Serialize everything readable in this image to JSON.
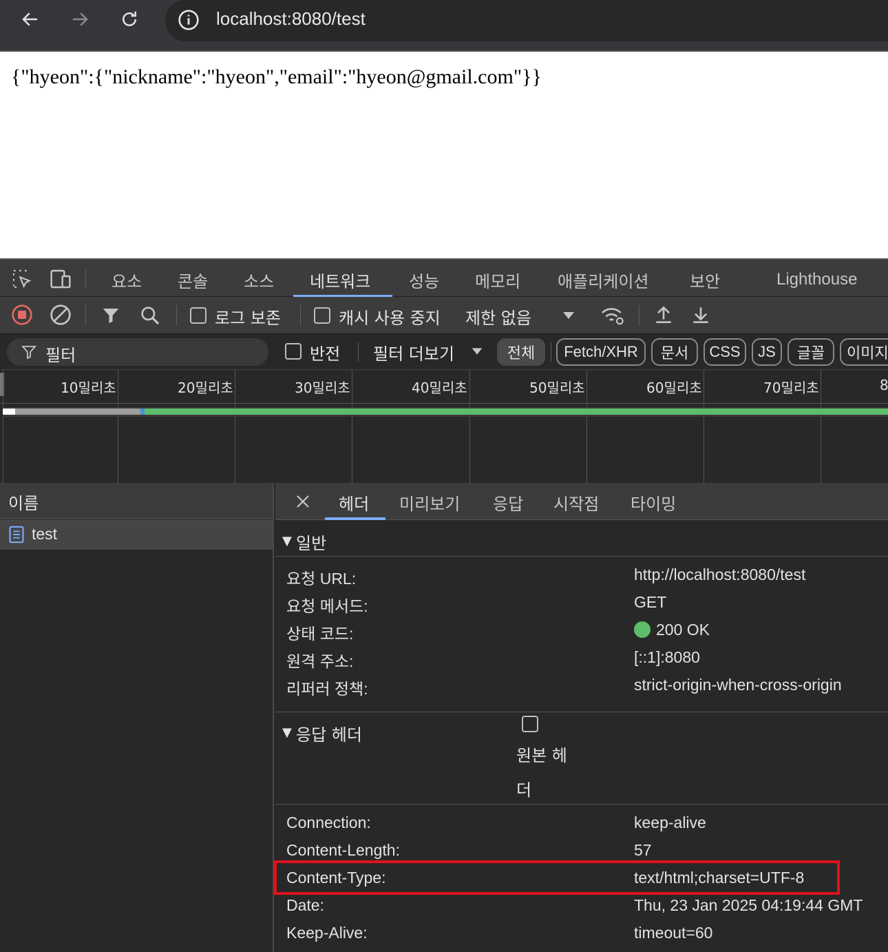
{
  "browser": {
    "url": "localhost:8080/test"
  },
  "page": {
    "body_text": "{\"hyeon\":{\"nickname\":\"hyeon\",\"email\":\"hyeon@gmail.com\"}}"
  },
  "devtools": {
    "main_tabs": [
      "요소",
      "콘솔",
      "소스",
      "네트워크",
      "성능",
      "메모리",
      "애플리케이션",
      "보안",
      "Lighthouse"
    ],
    "active_main_tab": "네트워크",
    "toolbar": {
      "preserve_log": "로그 보존",
      "disable_cache": "캐시 사용 중지",
      "throttling": "제한 없음"
    },
    "filter": {
      "placeholder": "필터",
      "invert": "반전",
      "more_filters": "필터 더보기",
      "types": [
        "전체",
        "Fetch/XHR",
        "문서",
        "CSS",
        "JS",
        "글꼴",
        "이미지"
      ],
      "active_type": "전체"
    },
    "timeline": {
      "ticks": [
        "10밀리초",
        "20밀리초",
        "30밀리초",
        "40밀리초",
        "50밀리초",
        "60밀리초",
        "70밀리초",
        "8"
      ]
    },
    "requests": {
      "column_name": "이름",
      "items": [
        {
          "name": "test"
        }
      ]
    },
    "details": {
      "tabs": [
        "헤더",
        "미리보기",
        "응답",
        "시작점",
        "타이밍"
      ],
      "active_tab": "헤더",
      "general": {
        "title": "일반",
        "rows": [
          {
            "key": "요청 URL:",
            "value": "http://localhost:8080/test"
          },
          {
            "key": "요청 메서드:",
            "value": "GET"
          },
          {
            "key": "상태 코드:",
            "value": "200 OK"
          },
          {
            "key": "원격 주소:",
            "value": "[::1]:8080"
          },
          {
            "key": "리퍼러 정책:",
            "value": "strict-origin-when-cross-origin"
          }
        ]
      },
      "response_headers": {
        "title": "응답 헤더",
        "raw_toggle_line1": "원본 헤",
        "raw_toggle_line2": "더",
        "rows": [
          {
            "key": "Connection:",
            "value": "keep-alive"
          },
          {
            "key": "Content-Length:",
            "value": "57"
          },
          {
            "key": "Content-Type:",
            "value": "text/html;charset=UTF-8"
          },
          {
            "key": "Date:",
            "value": "Thu, 23 Jan 2025 04:19:44 GMT"
          },
          {
            "key": "Keep-Alive:",
            "value": "timeout=60"
          }
        ]
      }
    }
  },
  "colors": {
    "accent": "#7cacf8",
    "status_ok": "#5ebd6a",
    "record": "#e46962",
    "highlight": "#e0121c"
  }
}
